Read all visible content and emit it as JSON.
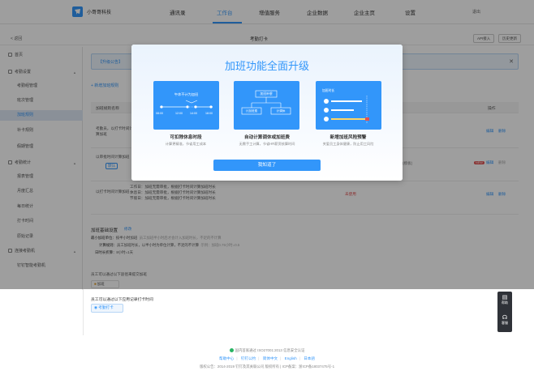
{
  "app": {
    "name": "小哥哥科技"
  },
  "nav": {
    "items": [
      "通讯录",
      "工作台",
      "增值服务",
      "企业数据",
      "企业主页",
      "设置"
    ],
    "active": "工作台",
    "exit": "退出"
  },
  "header": {
    "back": "< 返回",
    "title": "考勤打卡",
    "api_btn": "API接入",
    "history_btn": "历史更新"
  },
  "sidebar": {
    "items": [
      {
        "label": "首页",
        "group": true
      },
      {
        "label": "考勤设置",
        "group": true
      },
      {
        "label": "考勤组管理"
      },
      {
        "label": "班次管理"
      },
      {
        "label": "加班规则",
        "active": true
      },
      {
        "label": "补卡规则"
      },
      {
        "label": "假期管理"
      },
      {
        "label": "考勤统计",
        "group": true
      },
      {
        "label": "报表管理"
      },
      {
        "label": "月度汇总"
      },
      {
        "label": "每日统计"
      },
      {
        "label": "打卡时间"
      },
      {
        "label": "原始记录"
      },
      {
        "label": "连接考勤机",
        "group": true
      },
      {
        "label": "钉钉智能考勤机"
      }
    ]
  },
  "main": {
    "notice": "【升级公告】",
    "add_button": "+ 新增加班规则",
    "table": {
      "headers": [
        "加班规则名称",
        "操作"
      ],
      "rows": [
        {
          "name": "考勤员，以打卡时间计算加班",
          "ops": [
            "编辑",
            "删除"
          ]
        },
        {
          "name": "以审批时间计算加班",
          "tag": "默认",
          "extra": "(模板)",
          "new_tag": "NEW",
          "ops": [
            "编辑",
            "删除"
          ]
        },
        {
          "name": "以打卡时间计算加班",
          "details": [
            "工作日：加班无需审批，根据打卡时间计算加班时长",
            "休息日：加班无需审批，根据打卡时间计算加班时长",
            "节假日：加班无需审批，根据打卡时间计算加班时长"
          ],
          "status": "未使用",
          "ops": [
            "编辑",
            "删除"
          ]
        }
      ]
    },
    "settings": {
      "title": "加班基础设置",
      "edit": "修改",
      "lines": [
        {
          "label": "最小加班单位：",
          "value": "按半小时加班",
          "note": "员工加班半小时后才会计入加班时长，不足的不计算"
        },
        {
          "label": "计算规则：",
          "value": "员工加班时长，以半小时为单位计算，不足的不计算",
          "note": "示例：加班0.75小时=0.5"
        },
        {
          "label": "日时长折算：",
          "value": "8小时=1天"
        }
      ]
    },
    "punch_note": "员工可以通过以下途径来提交加班",
    "punch_chip": "加班"
  },
  "lower": {
    "text": "员工可以通过以下应用记录打卡时间",
    "chip": "考勤打卡"
  },
  "float": {
    "help": "帮助",
    "service": "客服"
  },
  "footer": {
    "line1": "国内首家通过 ISO27001:2013 信息安全认证",
    "links": [
      "帮助中心",
      "钉钉公约",
      "简体中文",
      "English",
      "日本語"
    ],
    "line3": "版权公告：2014-2019 钉钉及其关联公司 版权所有 | ICP备案：浙ICP备18037475号-1"
  },
  "modal": {
    "title": "加班功能全面升级",
    "features": [
      {
        "title": "可扣除休息时段",
        "desc": "计算更精准，节省用工成本",
        "panel": {
          "caption": "午休不计为加班",
          "ticks": [
            "08:00",
            "12:00",
            "14:00",
            "18:00"
          ]
        }
      },
      {
        "title": "自动计算调休或加班费",
        "desc": "无需手工计算，节省HR薪资核算时间",
        "panel": {
          "caption": "加班补偿",
          "left": "计加班费",
          "right": "计调休"
        }
      },
      {
        "title": "新增加班风险预警",
        "desc": "关爱员工身体健康，防止用工风险",
        "panel": {
          "caption": "加班时长"
        }
      }
    ],
    "ok": "我知道了"
  },
  "colors": {
    "accent": "#3296fa",
    "danger": "#e05252"
  }
}
